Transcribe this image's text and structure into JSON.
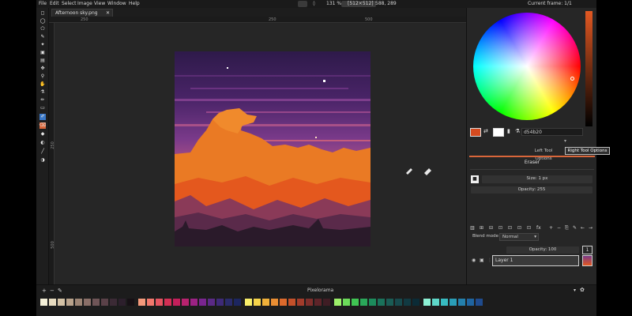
{
  "menu": [
    "File",
    "Edit",
    "Select",
    "Image",
    "View",
    "Window",
    "Help"
  ],
  "status": {
    "zoom": "131 %",
    "size": "[512×512]",
    "coords": "588, 289",
    "frame": "Current frame: 1/1"
  },
  "tab": {
    "title": "Afternoon sky.png",
    "close": "✕"
  },
  "ruler": {
    "h": [
      "250",
      "250",
      "500"
    ],
    "v": [
      "250",
      "500"
    ]
  },
  "color": {
    "left": "#d54b20",
    "right": "#ffffff",
    "hex": "d54b20"
  },
  "tool_options": {
    "left_tab": "Left Tool Options",
    "right_tab": "Right Tool Options",
    "tool_name": "Eraser",
    "size_label": "Size: 1 px",
    "opacity_label": "Opacity: 255"
  },
  "layers": {
    "blend_label": "Blend mode",
    "blend_value": "Normal",
    "opacity_label": "Opacity: 100",
    "layer_name": "Layer 1",
    "frame_number": "1"
  },
  "bottom": {
    "title": "Pixelorama",
    "add": "+",
    "remove": "−",
    "menu": "▾"
  },
  "palette": [
    "#f5f0d8",
    "#e8dcc0",
    "#d4c2a6",
    "#b9a38c",
    "#9c8474",
    "#8a6f68",
    "#6f5557",
    "#5a4148",
    "#3b2a35",
    "#2c1f2c",
    "#161015",
    "#f59a7c",
    "#f2786d",
    "#e65461",
    "#d42f55",
    "#c41f5b",
    "#b8226e",
    "#9c2284",
    "#7a2590",
    "#5b2a86",
    "#3e2a78",
    "#2a2b6b",
    "#1c2660",
    "#f8ee6a",
    "#f6d44a",
    "#f1b13a",
    "#ea8e33",
    "#dd6a2c",
    "#c5512a",
    "#a33c2b",
    "#7f2e2b",
    "#5e2429",
    "#3f1d24",
    "#9cf06a",
    "#6cdc5a",
    "#40c553",
    "#2aa85a",
    "#1c8c5c",
    "#1a725b",
    "#1a5c55",
    "#174a4d",
    "#113a42",
    "#0b2b36",
    "#8df0d4",
    "#5ed7c9",
    "#38bcc2",
    "#2a9db7",
    "#2480ad",
    "#1f64a0",
    "#1f4b8e"
  ]
}
